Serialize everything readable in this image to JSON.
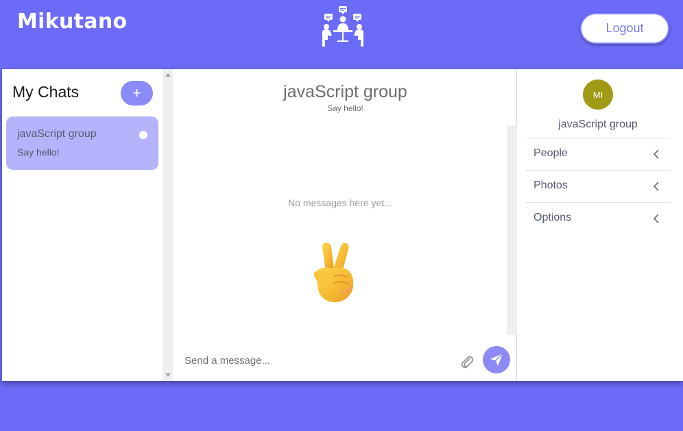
{
  "header": {
    "brand": "Mikutano",
    "logo_icon": "meeting-people-icon",
    "logout_label": "Logout"
  },
  "chats": {
    "title": "My Chats",
    "add_icon": "plus-icon",
    "add_label": "+",
    "items": [
      {
        "name": "javaScript group",
        "preview": "Say hello!",
        "unread": true
      }
    ]
  },
  "feed": {
    "title": "javaScript group",
    "subtitle": "Say hello!",
    "empty_text": "No messages here yet...",
    "empty_icon": "peace-hand-emoji",
    "input_placeholder": "Send a message...",
    "attach_icon": "paperclip-icon",
    "send_icon": "send-plane-icon"
  },
  "settings": {
    "avatar_initials": "MI",
    "avatar_color": "#a09a14",
    "title": "javaScript group",
    "sections": [
      {
        "label": "People",
        "icon": "chevron-left-icon"
      },
      {
        "label": "Photos",
        "icon": "chevron-left-icon"
      },
      {
        "label": "Options",
        "icon": "chevron-left-icon"
      }
    ]
  },
  "colors": {
    "background": "#6c6bf7",
    "accent": "#8b8af6",
    "active_chat": "#b4b3fb"
  }
}
